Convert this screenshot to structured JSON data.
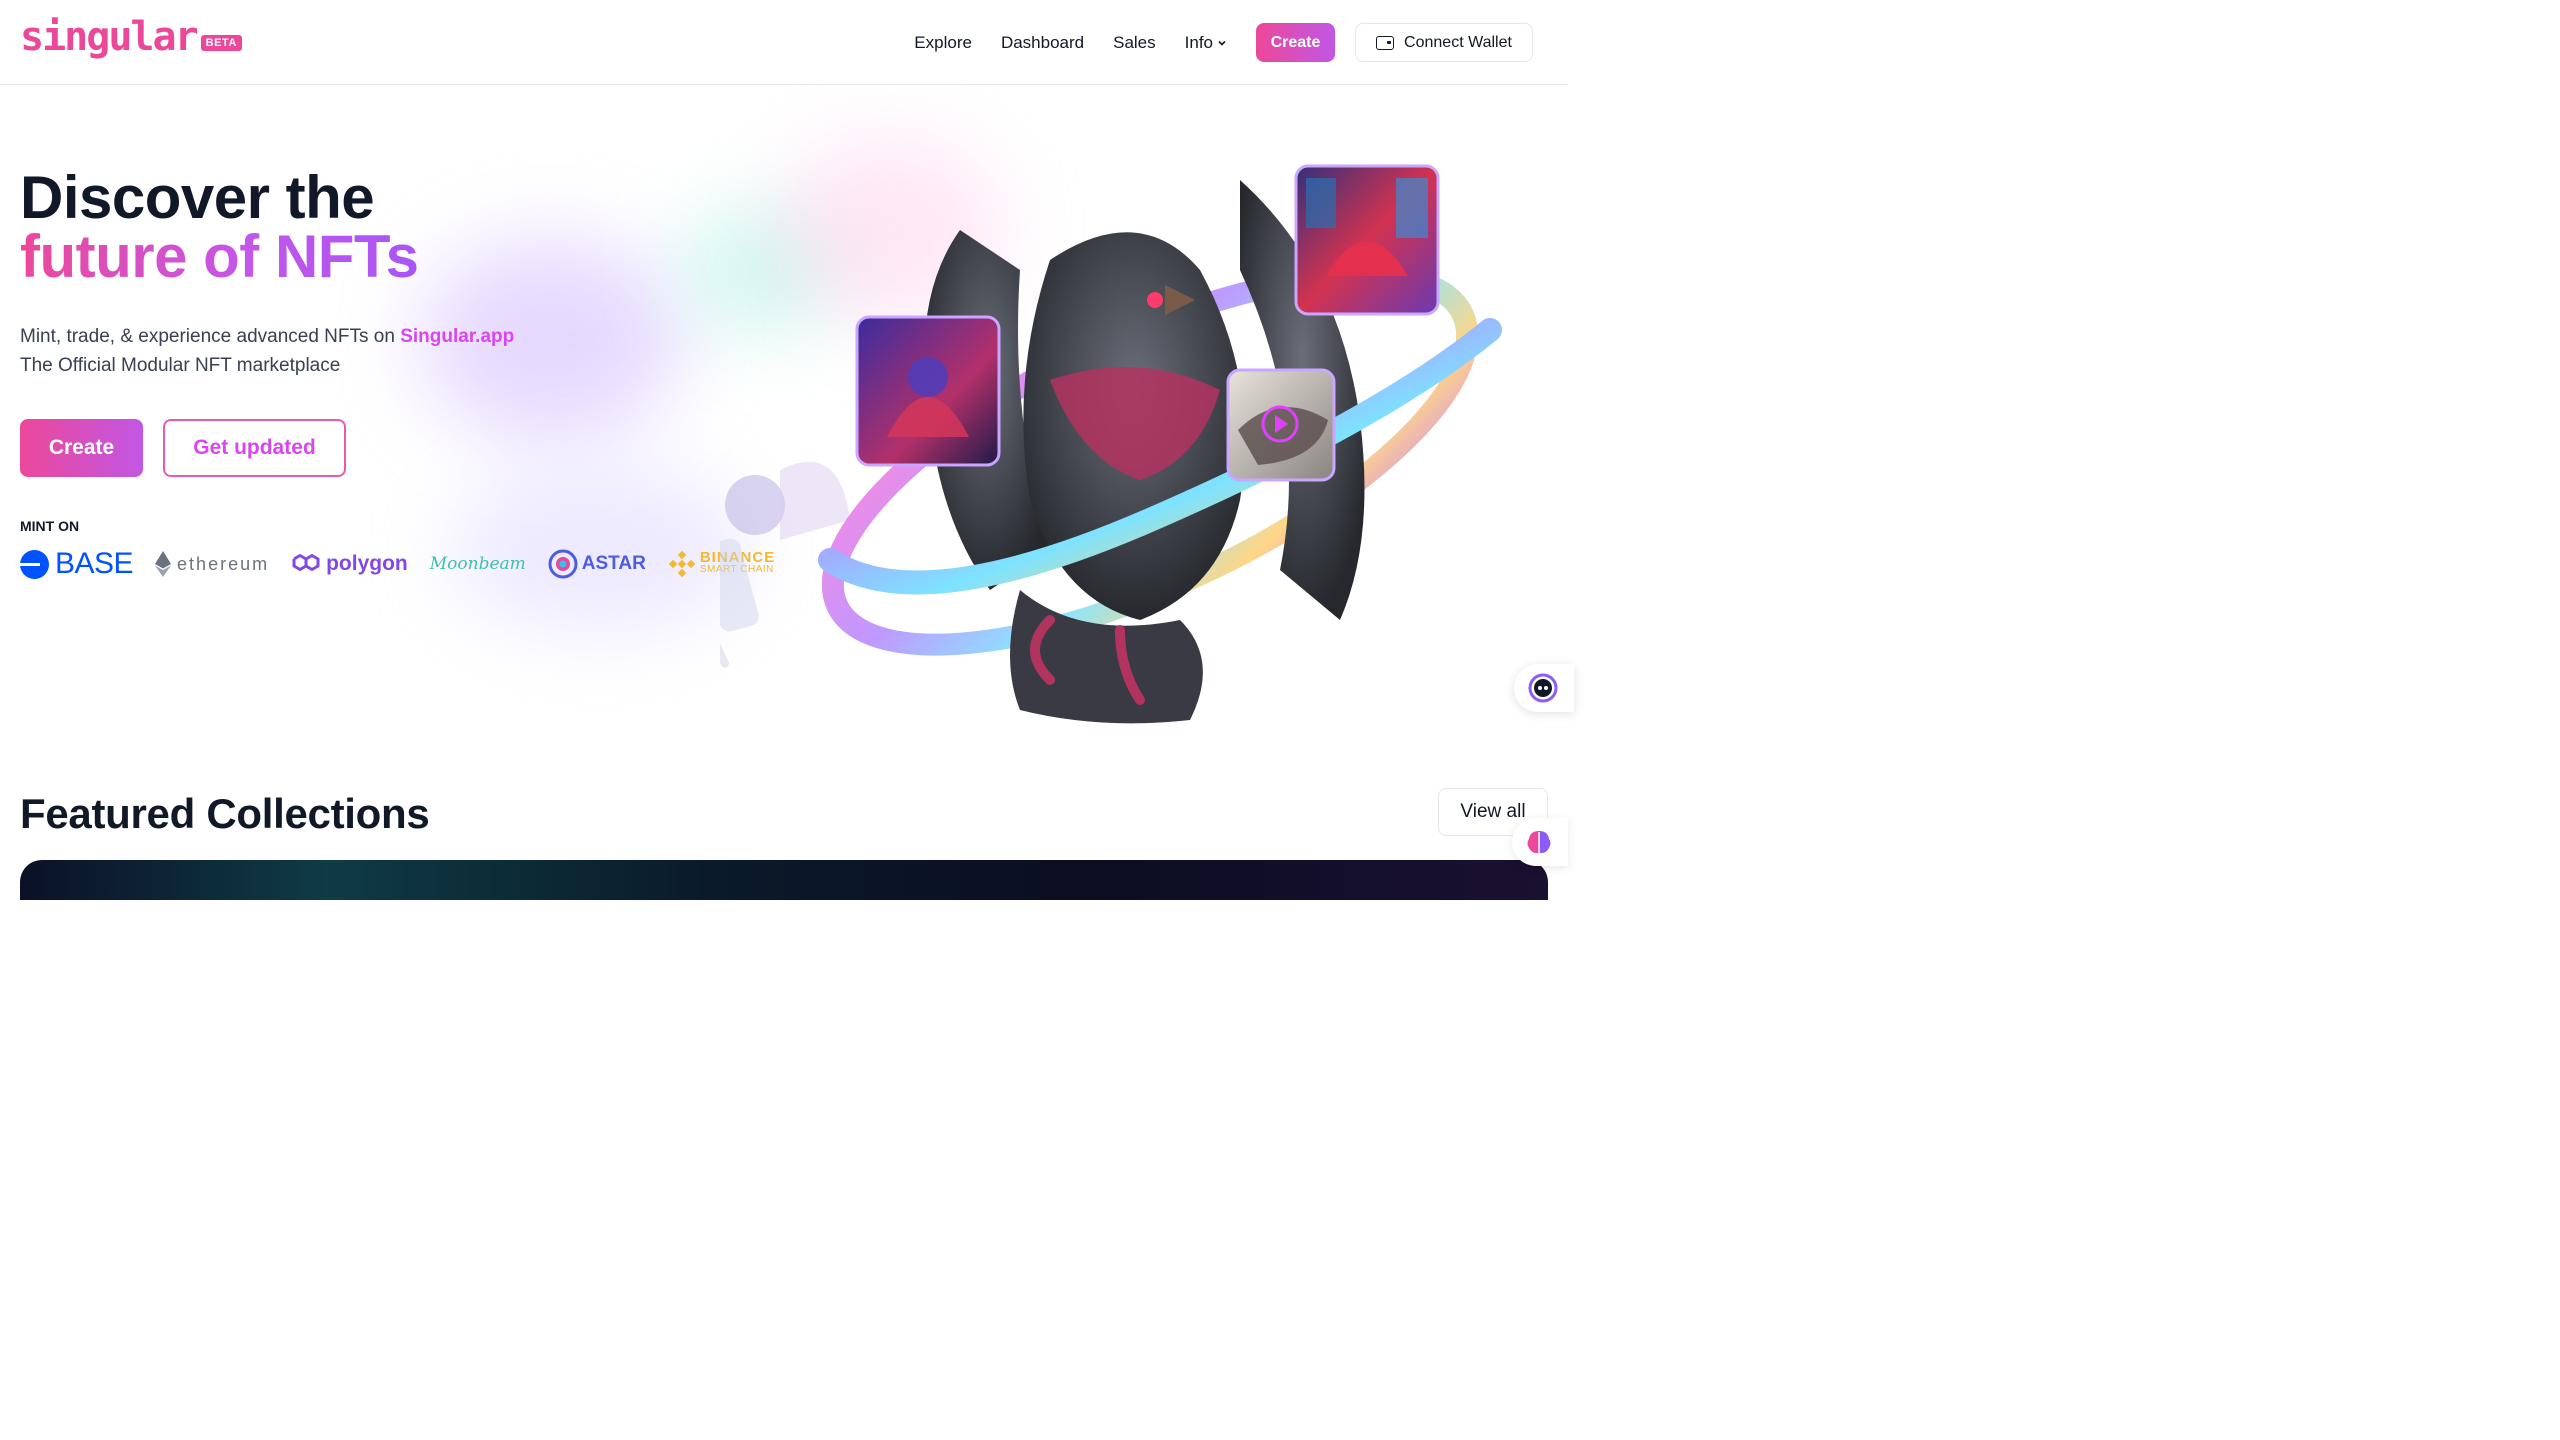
{
  "header": {
    "logo_text": "singular",
    "logo_badge": "BETA",
    "nav": {
      "explore": "Explore",
      "dashboard": "Dashboard",
      "sales": "Sales",
      "info": "Info"
    },
    "create_label": "Create",
    "wallet_label": "Connect Wallet"
  },
  "hero": {
    "title_line1": "Discover the",
    "title_line2": "future of NFTs",
    "subtitle_prefix": "Mint, trade, & experience advanced NFTs on ",
    "subtitle_accent": "Singular.app",
    "subtitle_line2": "The Official Modular NFT marketplace",
    "create_label": "Create",
    "updated_label": "Get updated",
    "mint_on_label": "MINT ON",
    "chains": {
      "base": "BASE",
      "ethereum": "ethereum",
      "polygon": "polygon",
      "moonbeam": "Moonbeam",
      "astar": "ASTAR",
      "binance_1": "BINANCE",
      "binance_2": "SMART CHAIN"
    }
  },
  "featured": {
    "title": "Featured Collections",
    "view_all_label": "View all"
  },
  "colors": {
    "brand_pink": "#ec4899",
    "brand_purple": "#a855f7",
    "base_blue": "#0052ff",
    "polygon_purple": "#8247e5",
    "binance_yellow": "#f3ba2f"
  }
}
